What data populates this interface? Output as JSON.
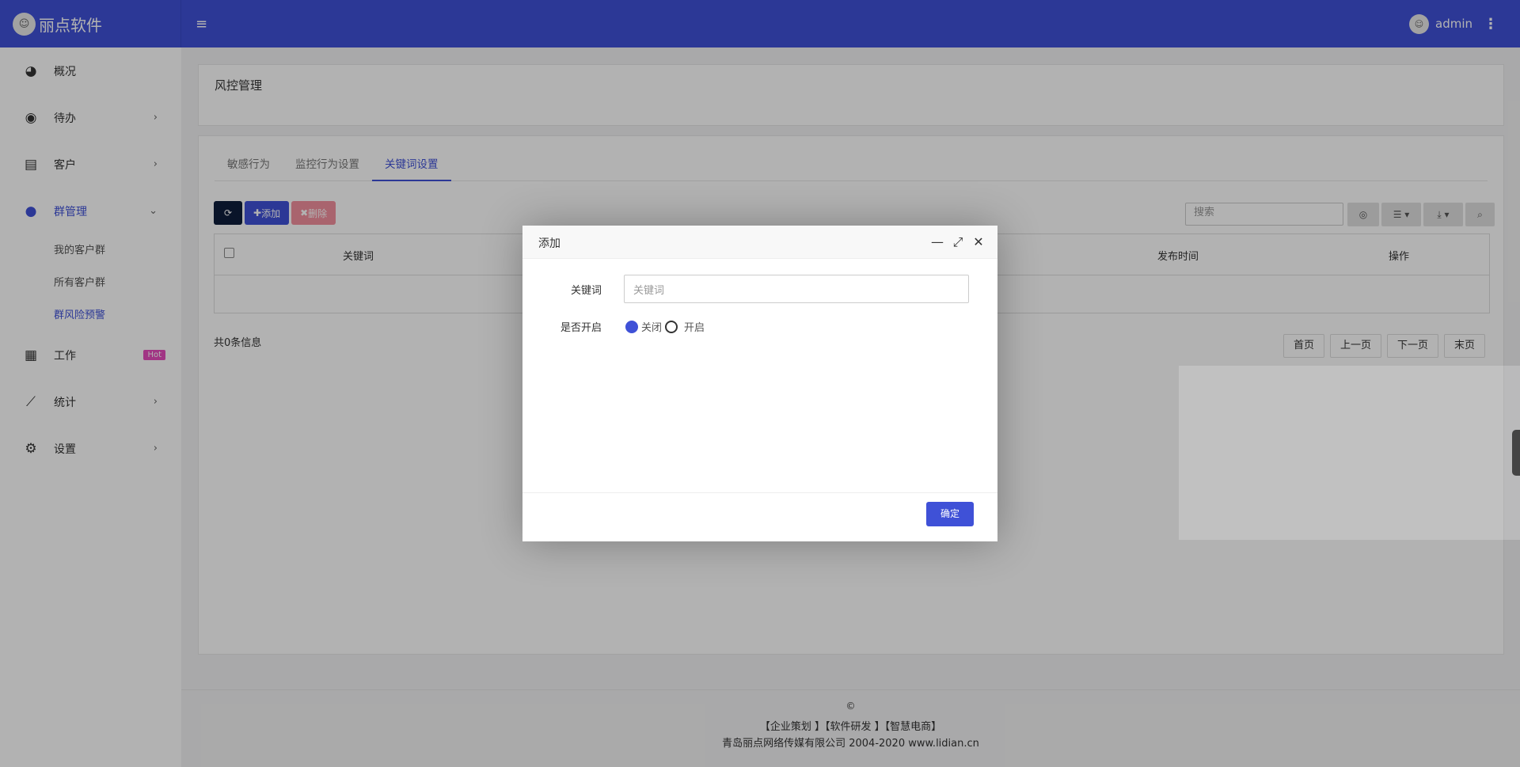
{
  "brand": {
    "name": "丽点软件",
    "logo_icon": "avatar-icon"
  },
  "header": {
    "username": "admin"
  },
  "sidebar": {
    "items": [
      {
        "label": "概况",
        "icon": "dashboard-icon"
      },
      {
        "label": "待办",
        "icon": "compass-icon"
      },
      {
        "label": "客户",
        "icon": "id-card-icon"
      },
      {
        "label": "群管理",
        "icon": "users-icon"
      },
      {
        "label": "工作",
        "icon": "grid-icon",
        "badge": "Hot"
      },
      {
        "label": "统计",
        "icon": "line-chart-icon"
      },
      {
        "label": "设置",
        "icon": "gear-icon"
      }
    ],
    "sub_items": [
      "我的客户群",
      "所有客户群",
      "群风险预警"
    ]
  },
  "page": {
    "title": "风控管理"
  },
  "tabs": [
    "敏感行为",
    "监控行为设置",
    "关键词设置"
  ],
  "toolbar": {
    "add_label": "添加",
    "delete_label": "删除"
  },
  "search": {
    "placeholder": "搜索"
  },
  "table": {
    "columns": [
      "关键词",
      "发布时间",
      "操作"
    ]
  },
  "total_info": "共0条信息",
  "pager": {
    "first": "首页",
    "prev": "上一页",
    "next": "下一页",
    "last": "末页"
  },
  "footer": {
    "copyright": "©",
    "links": "【企业策划 】【软件研发 】【智慧电商】",
    "company": "青岛丽点网络传媒有限公司 2004-2020 www.lidian.cn"
  },
  "modal": {
    "title": "添加",
    "keyword_label": "关键词",
    "keyword_placeholder": "关键词",
    "enable_label": "是否开启",
    "radio_off": "关闭",
    "radio_on": "开启",
    "confirm": "确定"
  },
  "colors": {
    "accent": "#3f51d7",
    "danger": "#f27d8e",
    "dark": "#0d1d3b",
    "hot": "#e74cbd"
  }
}
